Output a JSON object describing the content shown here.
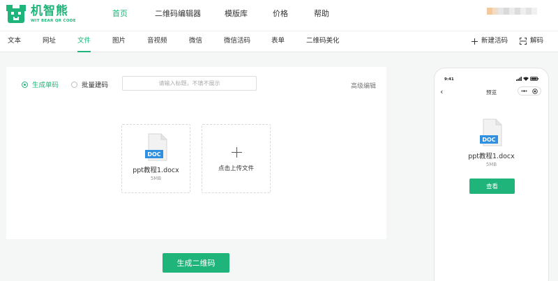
{
  "brand": {
    "name": "机智熊",
    "subtitle": "WIT BEAR QR CODE",
    "color": "#1fb57a"
  },
  "topnav": {
    "items": [
      "首页",
      "二维码编辑器",
      "模版库",
      "价格",
      "帮助"
    ],
    "active": "首页"
  },
  "subnav": {
    "items": [
      "文本",
      "网址",
      "文件",
      "图片",
      "音视频",
      "微信",
      "微信活码",
      "表单",
      "二维码美化"
    ],
    "active": "文件",
    "new_live_code": "新建活码",
    "decode": "解码"
  },
  "editor": {
    "mode_single": "生成单码",
    "mode_batch": "批量建码",
    "title_placeholder": "请输入标题，不填不展示",
    "advanced_edit": "高级编辑",
    "file": {
      "type_label": "DOC",
      "name": "ppt教程1.docx",
      "size": "5MB"
    },
    "upload_label": "点击上传文件",
    "generate_button": "生成二维码"
  },
  "preview": {
    "status_time": "9:41",
    "title": "预览",
    "file_type_label": "DOC",
    "file_name": "ppt教程1.docx",
    "file_size": "5MB",
    "view_button": "查看"
  }
}
